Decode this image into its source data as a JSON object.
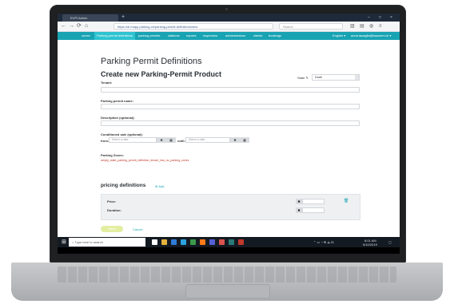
{
  "browser": {
    "tab_title": "EVPI Admin",
    "tab_add": "+",
    "win_min": "–",
    "win_max": "□",
    "win_close": "×",
    "url": "https://dl.mapp.parking.ch/parking-permit-definitions/new",
    "search_placeholder": "Search",
    "back": "←",
    "forward": "→",
    "reload": "⟳",
    "home": "⌂"
  },
  "app": {
    "brand": "",
    "menu": [
      "zones",
      "Parking permit definitions",
      "parking permits",
      "citations",
      "reports",
      "inspectors",
      "administrators",
      "clients",
      "bookings"
    ],
    "language": "English ▾",
    "user": "anna.lacaglia@bauwert.ch ▾"
  },
  "page": {
    "title": "Parking Permit Definitions",
    "subtitle": "Create new Parking-Permit Product",
    "tenant_label": "Tenant:",
    "state_label": "State",
    "state_value": "Draft",
    "permit_name_label": "Parking permit name:",
    "description_label": "Description (optional):",
    "conditioned_sale_label": "Conditioned sale (optional):",
    "from_label": "from:",
    "until_label": "until:",
    "date_placeholder": "Select a date",
    "clear_btn": "✖",
    "calendar_btn": "▦",
    "zones_label": "Parking Zones:",
    "zones_value": "simply_state_parking_permit_definition_tenant_has_no_parking_zones",
    "pricing_title": "pricing definitions",
    "add_label": "Add",
    "price_label": "Price:",
    "duration_label": "Duration:",
    "save_label": "Save",
    "cancel_label": "Cancel"
  },
  "taskbar": {
    "search_placeholder": "Type here to search",
    "time": "8:01 AM",
    "date": "5/10/2019"
  }
}
